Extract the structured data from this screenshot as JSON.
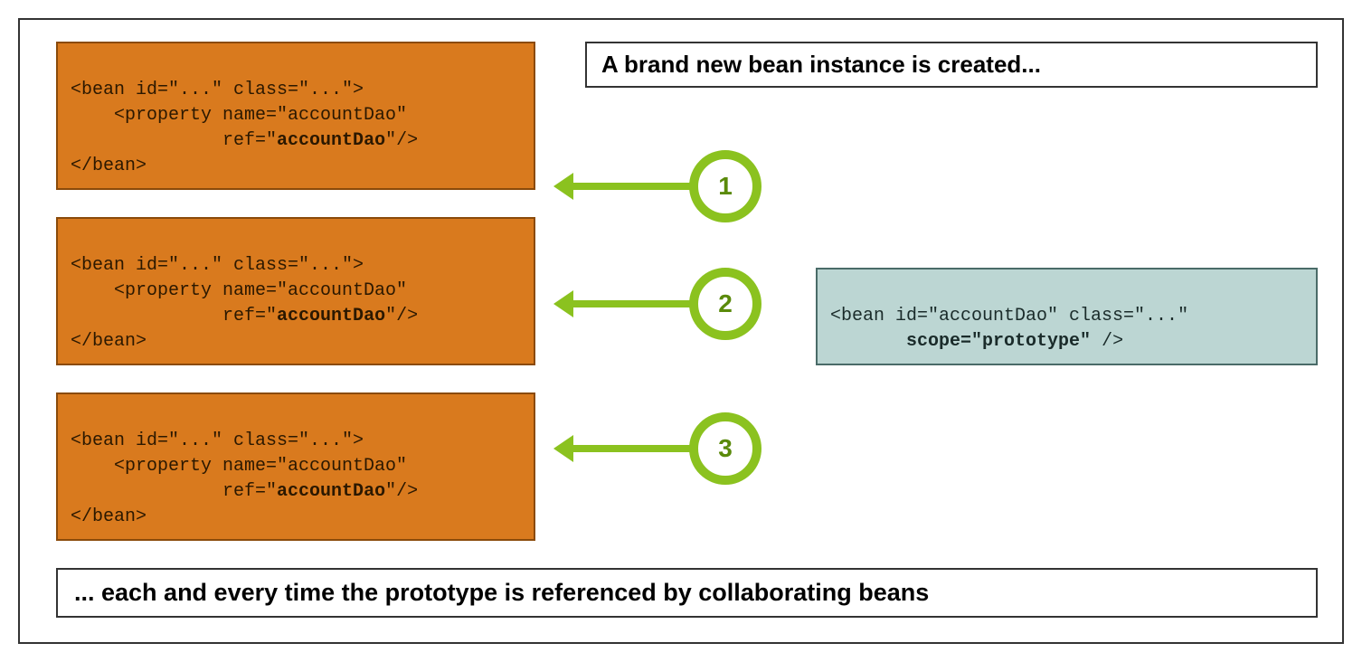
{
  "title": "A brand new bean instance is created...",
  "footer": "... each and every time the prototype is referenced by collaborating beans",
  "beanBox": {
    "line1": "<bean id=\"...\" class=\"...\">",
    "line2_prefix": "    <property name=\"accountDao\"",
    "line3_prefix": "              ref=\"",
    "line3_bold": "accountDao",
    "line3_suffix": "\"/>",
    "line4": "</bean>"
  },
  "protoBox": {
    "line1": "<bean id=\"accountDao\" class=\"...\"",
    "line2_prefix": "       ",
    "line2_bold": "scope=\"prototype\"",
    "line2_suffix": " />"
  },
  "circleNumbers": [
    "1",
    "2",
    "3"
  ]
}
